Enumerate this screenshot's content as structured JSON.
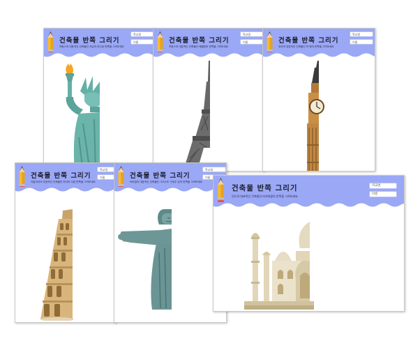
{
  "worksheets": [
    {
      "title": "건축물 반쪽 그리기",
      "description": "프랑스의 대표적인 건축물인 자유의 여신상 반쪽을 그려보세요",
      "fields": [
        "학교명",
        "이름"
      ],
      "landmark": "statue-of-liberty"
    },
    {
      "title": "건축물 반쪽 그리기",
      "description": "프랑스의 대표적인 건축물인 에펠탑의 반쪽을 그려보세요",
      "fields": [
        "학교명",
        "이름"
      ],
      "landmark": "eiffel-tower"
    },
    {
      "title": "건축물 반쪽 그리기",
      "description": "영국의 대표적인 건축물인 빅 벤의 반쪽을 그려보세요",
      "fields": [
        "학교명",
        "이름"
      ],
      "landmark": "big-ben"
    },
    {
      "title": "건축물 반쪽 그리기",
      "description": "이탈리아의 대표적인 건축물인 피사의 사탑 반쪽을 그려보세요",
      "fields": [
        "학교명",
        "이름"
      ],
      "landmark": "leaning-tower-of-pisa"
    },
    {
      "title": "건축물 반쪽 그리기",
      "description": "브라질의 대표적인 건축물인 그리스도 구세주 상의 반쪽을 그려보세요",
      "fields": [
        "학교명",
        "이름"
      ],
      "landmark": "christ-the-redeemer"
    },
    {
      "title": "건축물 반쪽 그리기",
      "description": "인도의 대표적인 건축물인 타지마할의 반쪽을 그려보세요",
      "fields": [
        "학교명",
        "이름"
      ],
      "landmark": "taj-mahal"
    }
  ],
  "colors": {
    "header": "#9aa8f6",
    "title_text": "#1c1c2a",
    "pencil_body": "#f5b930",
    "pencil_cap": "#e8554e"
  }
}
